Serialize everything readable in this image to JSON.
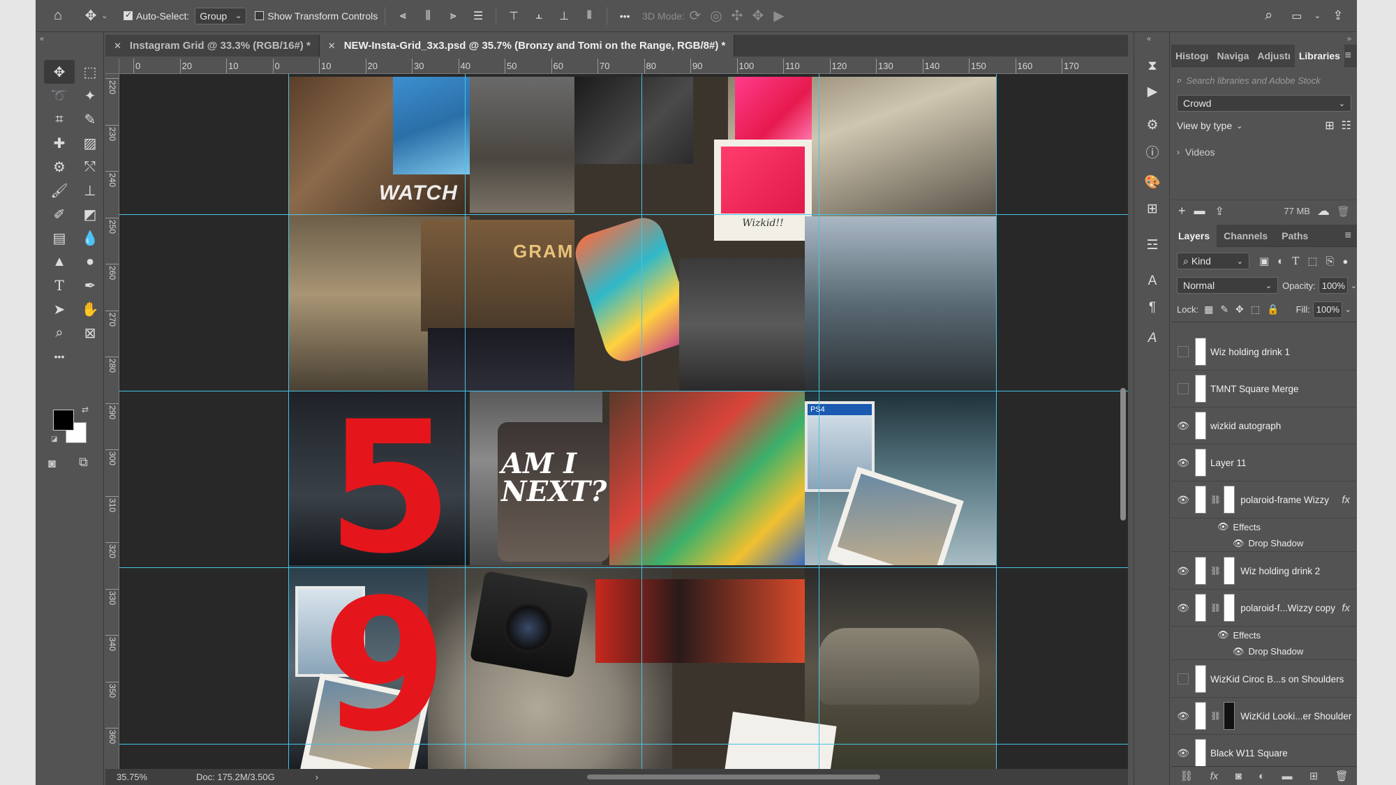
{
  "options_bar": {
    "auto_select_label": "Auto-Select:",
    "auto_select_value": "Group",
    "show_transform_label": "Show Transform Controls",
    "mode_3d_label": "3D Mode:",
    "more": "•••"
  },
  "tabs": [
    {
      "title": "Instagram Grid @ 33.3% (RGB/16#) *",
      "active": false
    },
    {
      "title": "NEW-Insta-Grid_3x3.psd @ 35.7% (Bronzy and Tomi on the Range, RGB/8#) *",
      "active": true
    }
  ],
  "ruler_h": [
    "0",
    "20",
    "10",
    "0",
    "10",
    "20",
    "30",
    "40",
    "50",
    "60",
    "70",
    "80",
    "90",
    "100",
    "110",
    "120",
    "130",
    "140",
    "150",
    "160",
    "170"
  ],
  "ruler_v": [
    "220",
    "230",
    "240",
    "250",
    "260",
    "270",
    "280",
    "290",
    "300",
    "310",
    "320",
    "330",
    "340",
    "350",
    "360"
  ],
  "artwork": {
    "numbers": [
      "5",
      "9"
    ],
    "texts": [
      "WATCH",
      "GRAM",
      "AM I NEXT?",
      "Wizkid!!",
      "PS4"
    ]
  },
  "status": {
    "zoom": "35.75%",
    "doc": "Doc: 175.2M/3.50G",
    "arrow": "›"
  },
  "libraries": {
    "tabs": [
      "Histogı",
      "Naviga",
      "Adjustı",
      "Libraries"
    ],
    "search_placeholder": "Search libraries and Adobe Stock",
    "library_name": "Crowd",
    "view_by": "View by type",
    "folder": "Videos",
    "size": "77 MB"
  },
  "layers_panel": {
    "tabs": [
      "Layers",
      "Channels",
      "Paths"
    ],
    "filter_kind": "Kind",
    "blend_mode": "Normal",
    "opacity_label": "Opacity:",
    "opacity_value": "100%",
    "lock_label": "Lock:",
    "fill_label": "Fill:",
    "fill_value": "100%",
    "effects_label": "Effects",
    "drop_shadow_label": "Drop Shadow",
    "fx_label": "fx",
    "layers": [
      {
        "name": "Wiz holding drink 1",
        "visible": false
      },
      {
        "name": "TMNT Square Merge",
        "visible": false
      },
      {
        "name": "wizkid autograph",
        "visible": true
      },
      {
        "name": "Layer 11",
        "visible": true
      },
      {
        "name": "polaroid-frame Wizzy",
        "visible": true,
        "fx": true
      },
      {
        "name": "Wiz holding drink 2",
        "visible": true
      },
      {
        "name": "polaroid-f...Wizzy copy",
        "visible": true,
        "fx": true
      },
      {
        "name": "WizKid Ciroc B...s on Shoulders",
        "visible": false
      },
      {
        "name": "WizKid Looki...er Shoulder",
        "visible": true
      },
      {
        "name": "Black W11 Square",
        "visible": true
      }
    ]
  },
  "colors": {
    "accent_guide": "#47c3e6",
    "number_red": "#e4161b",
    "panel_bg": "#535353"
  }
}
